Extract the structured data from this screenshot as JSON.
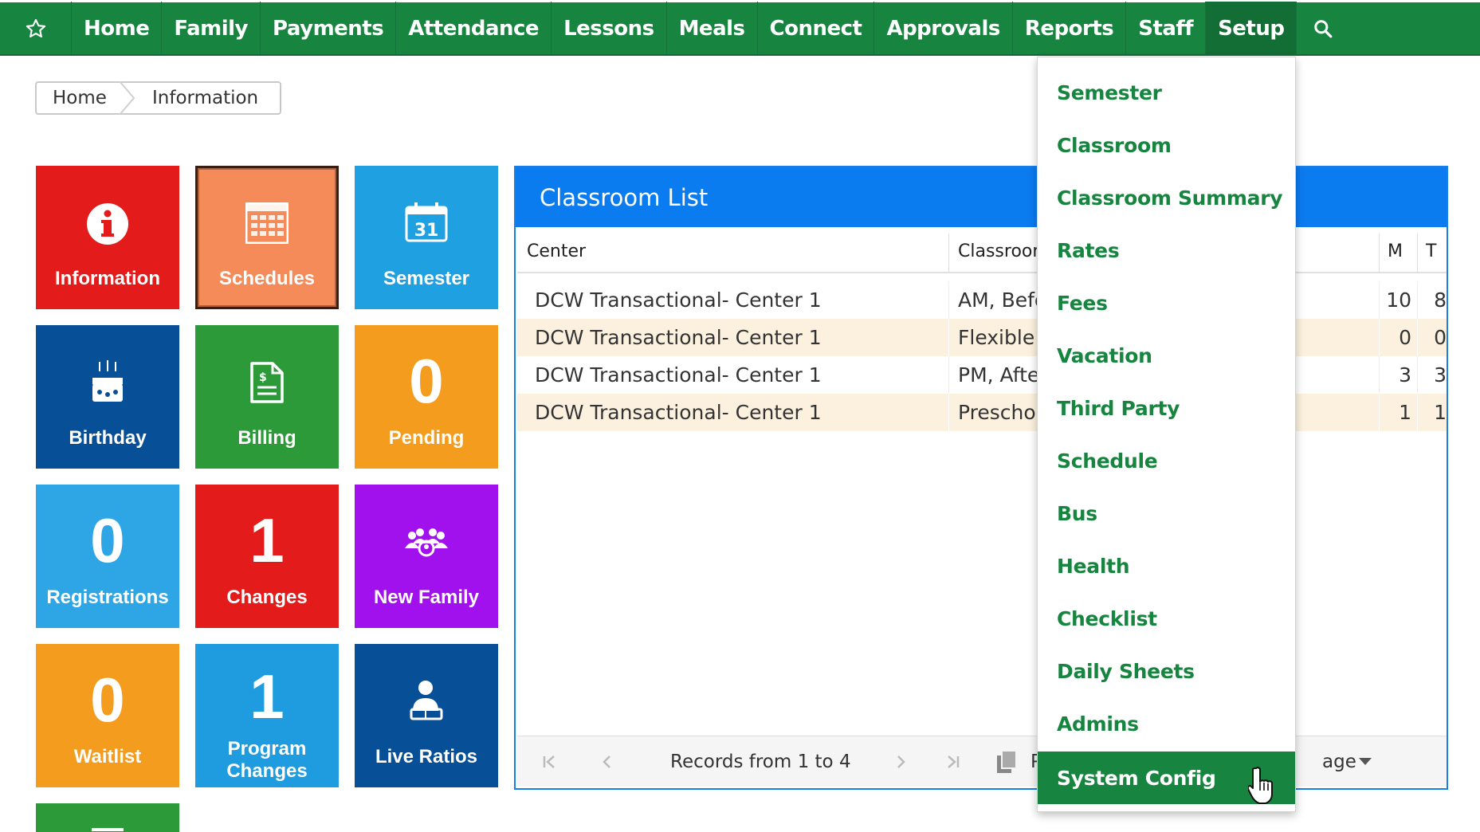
{
  "nav": {
    "items": [
      "Home",
      "Family",
      "Payments",
      "Attendance",
      "Lessons",
      "Meals",
      "Connect",
      "Approvals",
      "Reports",
      "Staff",
      "Setup"
    ],
    "active": "Setup",
    "icons": {
      "favorite": "star-icon",
      "search": "search-icon"
    }
  },
  "breadcrumb": {
    "home": "Home",
    "current": "Information"
  },
  "tiles": [
    {
      "label": "Information",
      "icon": "info-icon",
      "color": "#e41b1b"
    },
    {
      "label": "Schedules",
      "icon": "calendar-grid-icon",
      "color": "#f58b58"
    },
    {
      "label": "Semester",
      "icon": "calendar-31-icon",
      "color": "#1fa0e0"
    },
    {
      "label": "Birthday",
      "icon": "birthday-cake-icon",
      "color": "#074f97"
    },
    {
      "label": "Billing",
      "icon": "invoice-icon",
      "color": "#2d9a3a"
    },
    {
      "label": "Pending",
      "count": "0",
      "color": "#f39c1e"
    },
    {
      "label": "Registrations",
      "count": "0",
      "color": "#2ea6e6"
    },
    {
      "label": "Changes",
      "count": "1",
      "color": "#e41b1b"
    },
    {
      "label": "New Family",
      "icon": "family-group-icon",
      "color": "#a011ee"
    },
    {
      "label": "Waitlist",
      "count": "0",
      "color": "#f39c1e"
    },
    {
      "label": "Program Changes",
      "count": "1",
      "color": "#1f9be0"
    },
    {
      "label": "Live Ratios",
      "icon": "teacher-icon",
      "color": "#074f97"
    }
  ],
  "classroom_list": {
    "title": "Classroom List",
    "columns": [
      "Center",
      "Classroom",
      "M",
      "T"
    ],
    "rows": [
      {
        "center": "DCW Transactional- Center 1",
        "classroom": "AM, Befo",
        "m": "10",
        "t": "8"
      },
      {
        "center": "DCW Transactional- Center 1",
        "classroom": "Flexible C",
        "m": "0",
        "t": "0"
      },
      {
        "center": "DCW Transactional- Center 1",
        "classroom": "PM, Afte",
        "m": "3",
        "t": "3"
      },
      {
        "center": "DCW Transactional- Center 1",
        "classroom": "Preschoc",
        "m": "1",
        "t": "1"
      }
    ],
    "pager": {
      "records": "Records from 1 to 4",
      "page_fragment_left": "P",
      "page_fragment_right": "age"
    }
  },
  "setup_menu": {
    "items": [
      "Semester",
      "Classroom",
      "Classroom Summary",
      "Rates",
      "Fees",
      "Vacation",
      "Third Party",
      "Schedule",
      "Bus",
      "Health",
      "Checklist",
      "Daily Sheets",
      "Admins",
      "System Config"
    ],
    "hovered": "System Config"
  },
  "colors": {
    "nav_green": "#17843f",
    "panel_blue": "#0b7bf0",
    "row_alt": "#fbf1de"
  }
}
